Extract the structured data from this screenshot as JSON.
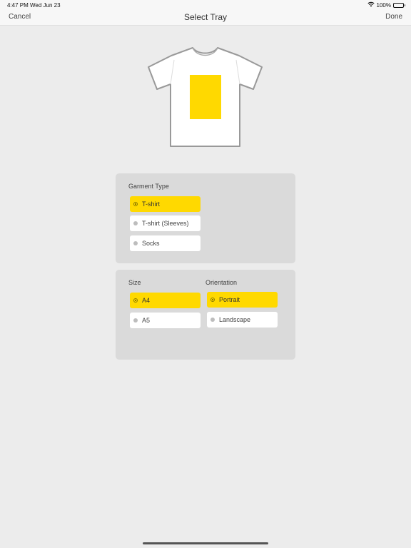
{
  "status_bar": {
    "time": "4:47 PM",
    "date": "Wed Jun 23",
    "battery": "100%"
  },
  "nav": {
    "cancel_label": "Cancel",
    "title": "Select Tray",
    "done_label": "Done"
  },
  "colors": {
    "accent": "#ffd900",
    "background": "#ececec",
    "panel": "#dadada"
  },
  "garment": {
    "label": "Garment Type",
    "options": [
      {
        "label": "T-shirt",
        "selected": true
      },
      {
        "label": "T-shirt (Sleeves)",
        "selected": false
      },
      {
        "label": "Socks",
        "selected": false
      }
    ]
  },
  "size": {
    "label": "Size",
    "options": [
      {
        "label": "A4",
        "selected": true
      },
      {
        "label": "A5",
        "selected": false
      }
    ]
  },
  "orientation": {
    "label": "Orientation",
    "options": [
      {
        "label": "Portrait",
        "selected": true
      },
      {
        "label": "Landscape",
        "selected": false
      }
    ]
  }
}
